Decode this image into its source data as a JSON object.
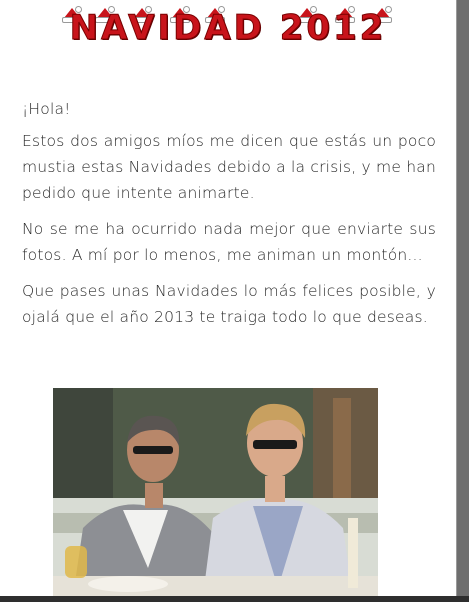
{
  "document": {
    "title": "NAVIDAD 2012",
    "paragraphs": [
      "¡Hola!",
      "Estos dos amigos míos me dicen que estás un poco mustia estas Navidades debido a la crisis, y me han pedido que intente animarte.",
      "No se me ha ocurrido nada mejor que enviarte sus fotos. A mí por lo menos, me animan un montón...",
      "Que pases unas Navidades lo más felices posible, y ojalá que el año 2013 te traiga todo lo que deseas."
    ]
  },
  "icons": [
    "santa-hat-icon"
  ],
  "colors": {
    "title": "#c8141b",
    "text": "#2a2a2a",
    "background": "#ffffff"
  }
}
